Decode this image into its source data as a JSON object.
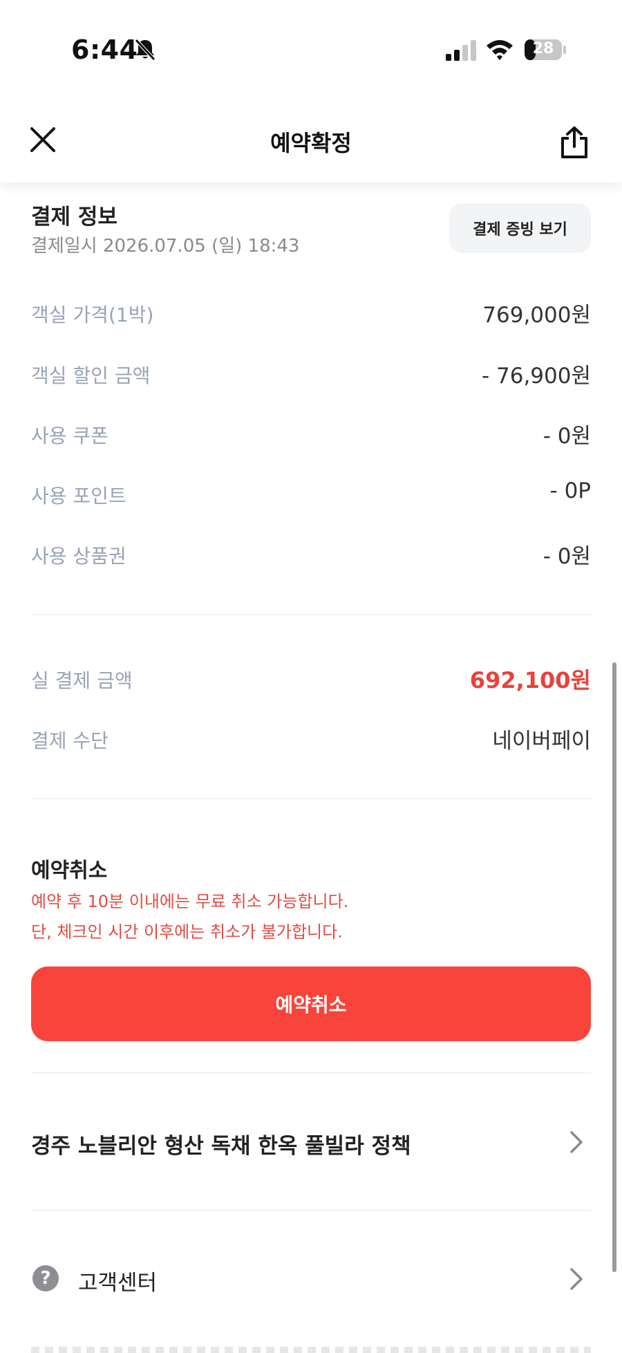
{
  "status_bar": {
    "time": "6:44",
    "battery": "28"
  },
  "nav": {
    "title": "예약확정"
  },
  "payment": {
    "title": "결제 정보",
    "date": "결제일시 2026.07.05 (일) 18:43",
    "receipt_button": "결제 증빙 보기",
    "rows": [
      {
        "label": "객실 가격(1박)",
        "value": "769,000원"
      },
      {
        "label": "객실 할인 금액",
        "value": "- 76,900원"
      },
      {
        "label": "사용 쿠폰",
        "value": "- 0원"
      },
      {
        "label": "사용 포인트",
        "value": "- 0P"
      },
      {
        "label": "사용 상품권",
        "value": "- 0원"
      }
    ],
    "total_label": "실 결제 금액",
    "total_value": "692,100원",
    "method_label": "결제 수단",
    "method_value": "네이버페이"
  },
  "cancel": {
    "title": "예약취소",
    "note_1": "예약 후 10분 이내에는 무료 취소 가능합니다.",
    "note_2": "단, 체크인 시간 이후에는 취소가 불가합니다.",
    "button": "예약취소"
  },
  "policy": {
    "label": "경주 노블리안 형산 독채 한옥 풀빌라 정책"
  },
  "support": {
    "label": "고객센터",
    "icon": "?"
  },
  "colors": {
    "accent": "#f8443b",
    "total": "#e8423a",
    "label": "#97a3b6"
  }
}
